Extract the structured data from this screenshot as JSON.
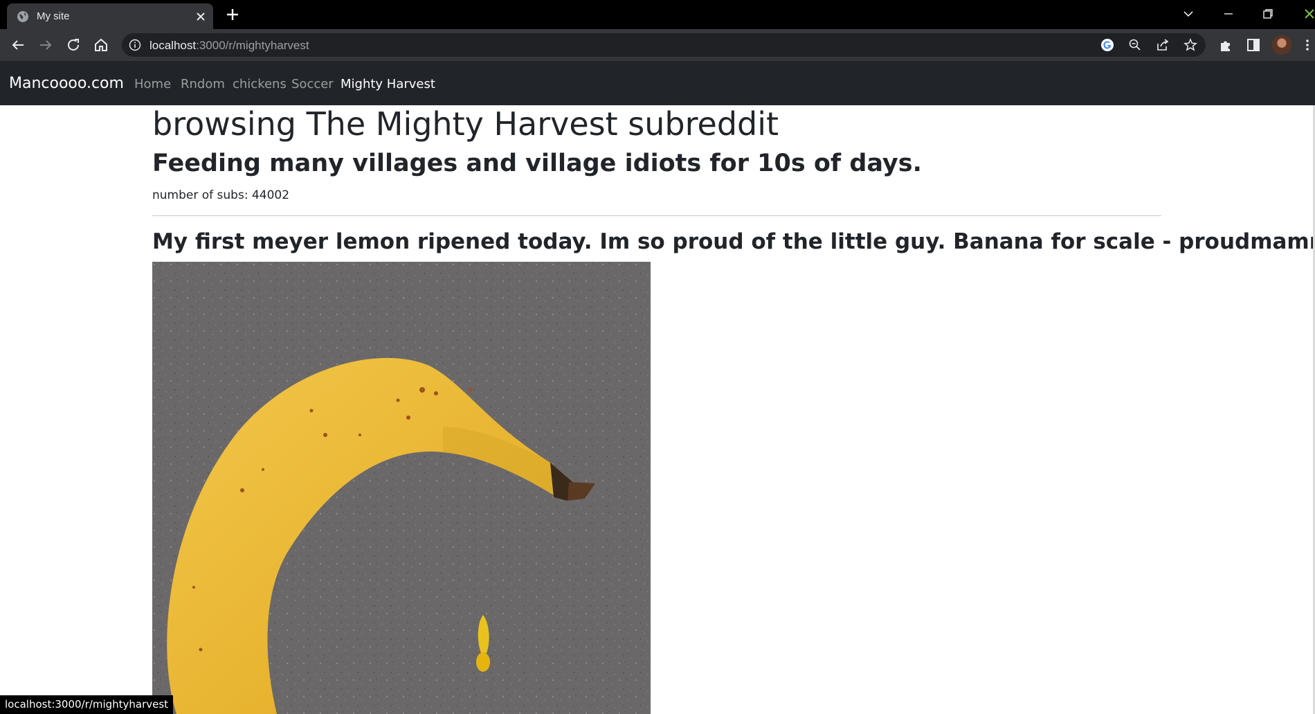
{
  "browser": {
    "tab_title": "My site",
    "url_host": "localhost",
    "url_path": ":3000/r/mightyharvest",
    "status_url": "localhost:3000/r/mightyharvest"
  },
  "navbar": {
    "brand": "Mancoooo.com",
    "links": [
      "Home",
      "Rndom",
      "chickens",
      "Soccer",
      "Mighty Harvest"
    ],
    "active_link": "Mighty Harvest"
  },
  "page": {
    "title": "browsing The Mighty Harvest subreddit",
    "subtitle": "Feeding many villages and village idiots for 10s of days.",
    "subs_line": "number of subs: 44002"
  },
  "post": {
    "title": "My first meyer lemon ripened today. Im so proud of the little guy. Banana for scale - ",
    "author": "proudmamma",
    "image_description": "banana next to a tiny lemon on grey stone countertop"
  },
  "icons": {
    "tab_favicon": "globe-icon",
    "tab_close": "close-icon",
    "new_tab": "plus-icon",
    "back": "arrow-left-icon",
    "forward": "arrow-right-icon",
    "reload": "reload-icon",
    "home": "home-icon",
    "site_info": "info-icon",
    "google": "google-icon",
    "zoom": "zoom-out-icon",
    "share": "share-icon",
    "bookmark": "star-icon",
    "extensions": "puzzle-icon",
    "side_panel": "side-panel-icon",
    "menu": "kebab-menu-icon"
  },
  "colors": {
    "navbar_bg": "#212529",
    "chrome_bg": "#35363a",
    "titlebar_bg": "#000000"
  }
}
